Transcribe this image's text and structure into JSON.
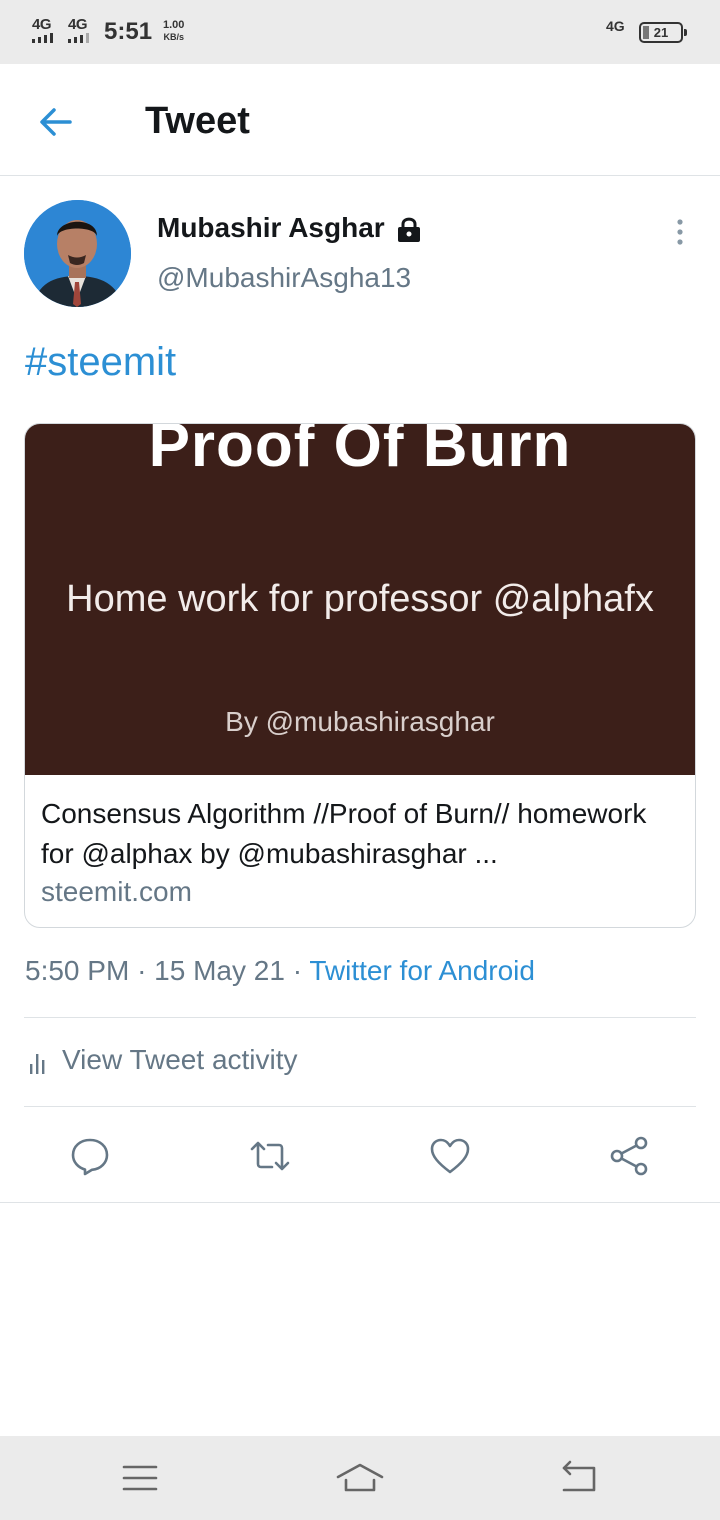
{
  "status_bar": {
    "network_1": "4G",
    "network_2": "4G",
    "time": "5:51",
    "speed_value": "1.00",
    "speed_unit": "KB/s",
    "sim_label": "4G",
    "battery": "21"
  },
  "header": {
    "title": "Tweet",
    "back_icon": "arrow-left-icon"
  },
  "tweet": {
    "author_name": "Mubashir Asghar",
    "author_handle": "@MubashirAsgha13",
    "protected_icon": "lock-icon",
    "more_icon": "more-vertical-icon",
    "text": "#steemit",
    "card": {
      "image_title": "Proof Of Burn",
      "image_subtitle": "Home work for professor @alphafx",
      "image_byline": "By @mubashirasghar",
      "title": "Consensus Algorithm //Proof of Burn// homework for @alphax by @mubashirasghar ...",
      "domain": "steemit.com"
    },
    "time": "5:50 PM",
    "separator": "·",
    "date": "15 May 21",
    "source": "Twitter for Android",
    "activity_label": "View Tweet activity"
  },
  "actions": [
    "reply-icon",
    "retweet-icon",
    "like-icon",
    "share-icon"
  ],
  "nav_bar": [
    "menu-icon",
    "home-icon",
    "back-icon"
  ],
  "colors": {
    "accent": "#2c8fd4",
    "secondary_text": "#657786",
    "card_image_bg": "#3c1f19"
  }
}
